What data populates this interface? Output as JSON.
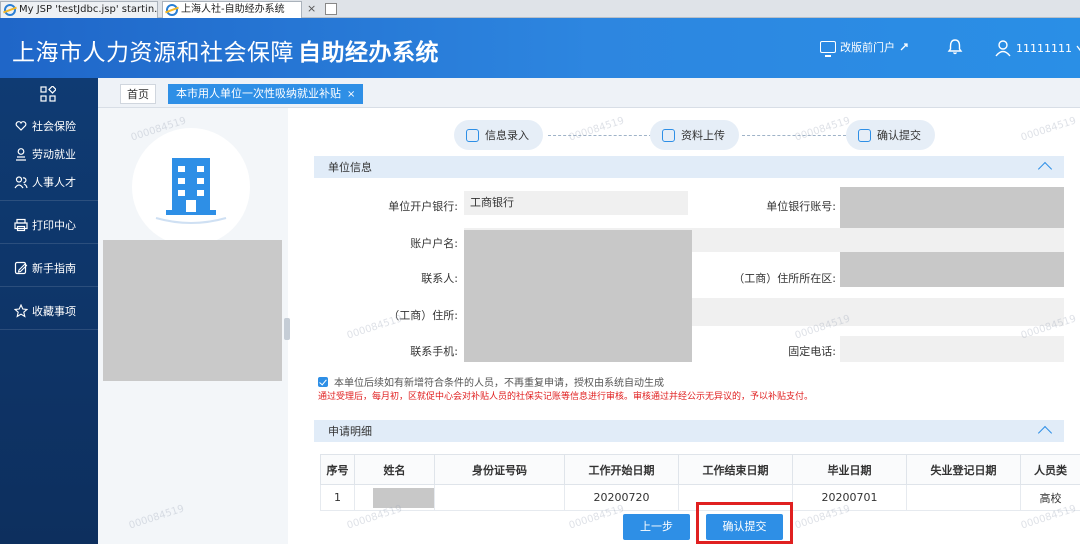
{
  "browser": {
    "tabs": [
      {
        "label": "My JSP 'testJdbc.jsp' startin...",
        "active": false
      },
      {
        "label": "上海人社-自助经办系统",
        "active": true
      }
    ],
    "close_glyph": "×"
  },
  "header": {
    "title_main": "上海市人力资源和社会保障",
    "title_bold": "自助经办系统",
    "portal_link": "改版前门户",
    "user": "11111111",
    "icons": [
      "monitor-icon",
      "link-icon",
      "bell-icon",
      "user-icon",
      "chevron-down-icon"
    ]
  },
  "sidebar": {
    "items": [
      {
        "label": "社会保险",
        "icon": "heart-hand-icon"
      },
      {
        "label": "劳动就业",
        "icon": "person-badge-icon"
      },
      {
        "label": "人事人才",
        "icon": "people-icon"
      },
      {
        "label": "打印中心",
        "icon": "printer-icon"
      },
      {
        "label": "新手指南",
        "icon": "edit-icon"
      },
      {
        "label": "收藏事项",
        "icon": "star-icon"
      }
    ]
  },
  "page_tabs": {
    "home": "首页",
    "current": "本市用人单位一次性吸纳就业补贴",
    "close": "×"
  },
  "wizard": {
    "steps": [
      "信息录入",
      "资料上传",
      "确认提交"
    ]
  },
  "unit_info": {
    "section_title": "单位信息",
    "fields": {
      "bank_label": "单位开户银行:",
      "bank_value": "工商银行",
      "account_no_label": "单位银行账号:",
      "account_name_label": "账户户名:",
      "contact_label": "联系人:",
      "district_label": "（工商）住所所在区:",
      "address_label": "（工商）住所:",
      "mobile_label": "联系手机:",
      "phone_label": "固定电话:"
    },
    "auth_checkbox": "本单位后续如有新增符合条件的人员，不再重复申请，授权由系统自动生成",
    "notice": "通过受理后，每月初，区就促中心会对补贴人员的社保实记账等信息进行审核。审核通过并经公示无异议的，予以补贴支付。"
  },
  "detail": {
    "section_title": "申请明细",
    "columns": [
      "序号",
      "姓名",
      "身份证号码",
      "工作开始日期",
      "工作结束日期",
      "毕业日期",
      "失业登记日期",
      "人员类"
    ],
    "rows": [
      {
        "seq": "1",
        "name": "",
        "id": "",
        "start": "20200720",
        "end": "",
        "grad": "20200701",
        "unemp": "",
        "type": "高校"
      }
    ]
  },
  "buttons": {
    "prev": "上一步",
    "submit": "确认提交"
  },
  "watermark": "000084519",
  "colors": {
    "header_blue": "#2d86e0",
    "sidebar_navy": "#0f3b73",
    "accent": "#2e8fe6",
    "alert_red": "#e02020"
  }
}
